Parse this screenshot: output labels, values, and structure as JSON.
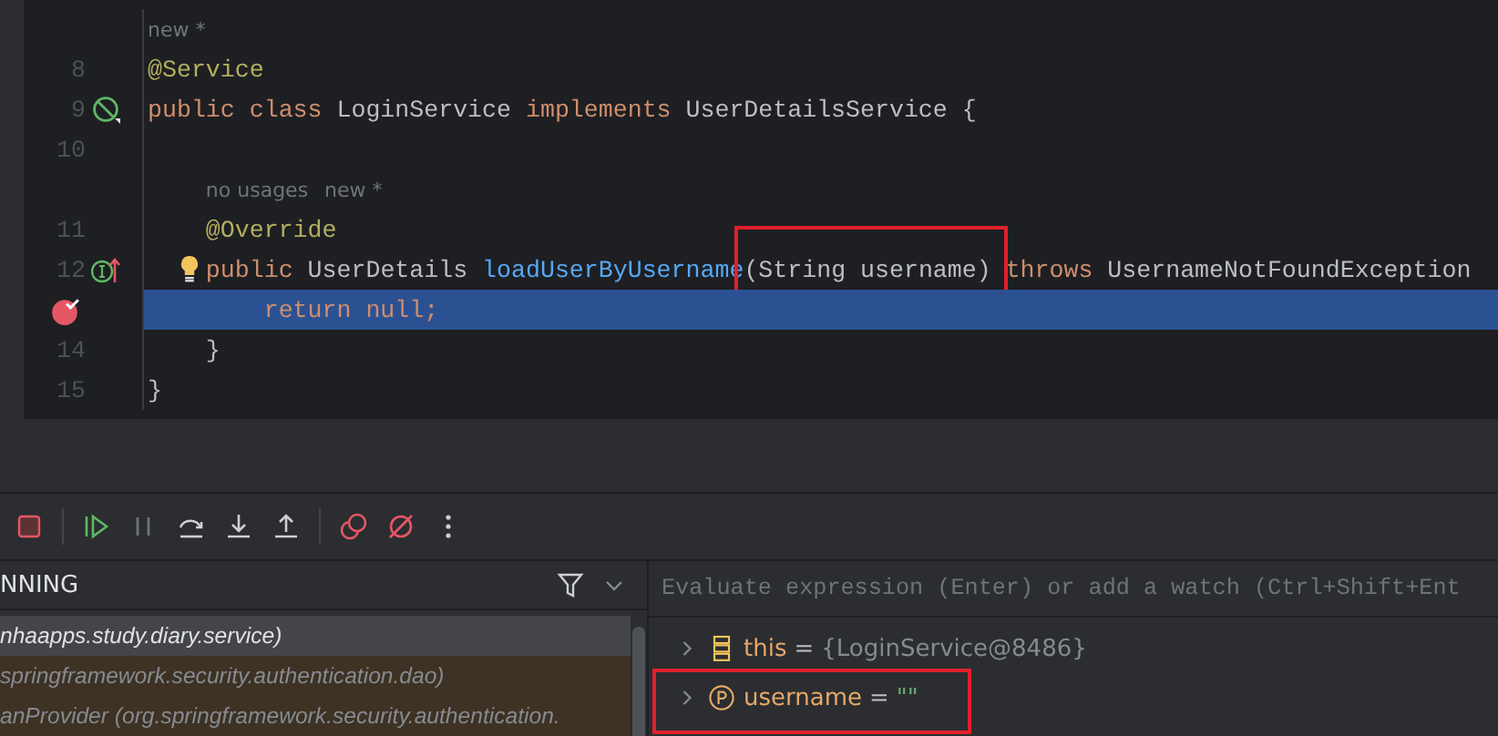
{
  "editor": {
    "lines": [
      {
        "kind": "annotation",
        "number": "8",
        "hints": [
          "new *"
        ],
        "tokens": [
          {
            "text": "@Service",
            "kind": "annotation"
          }
        ]
      },
      {
        "kind": "class",
        "number": "9",
        "tokens": [
          {
            "text": "public class",
            "kind": "keyword"
          },
          {
            "text": " LoginService ",
            "kind": "plain"
          },
          {
            "text": "implements",
            "kind": "keyword"
          },
          {
            "text": " UserDetailsService {",
            "kind": "plain"
          }
        ]
      },
      {
        "kind": "blank",
        "number": "10"
      },
      {
        "kind": "annotation",
        "number": "11",
        "hints": [
          "no usages",
          "new *"
        ],
        "tokens": [
          {
            "text": "    @Override",
            "kind": "annotation"
          }
        ]
      },
      {
        "kind": "method",
        "number": "12",
        "bulb": true,
        "tokens": [
          {
            "text": "    public",
            "kind": "keyword"
          },
          {
            "text": " UserDetails ",
            "kind": "plain"
          },
          {
            "text": "loadUserByUsername",
            "kind": "method"
          },
          {
            "text": "(String username)",
            "kind": "plain",
            "marked": true
          },
          {
            "text": " throws",
            "kind": "keyword"
          },
          {
            "text": " UsernameNotFoundException",
            "kind": "plain"
          }
        ]
      },
      {
        "kind": "statement",
        "breakpoint": true,
        "current": true,
        "tokens": [
          {
            "text": "        return null;",
            "kind": "keyword"
          }
        ]
      },
      {
        "kind": "brace",
        "number": "14",
        "tokens": [
          {
            "text": "    }",
            "kind": "plain"
          }
        ]
      },
      {
        "kind": "brace",
        "number": "15",
        "tokens": [
          {
            "text": "}",
            "kind": "plain"
          }
        ]
      }
    ]
  },
  "frames": {
    "header": "NNING",
    "rows": [
      {
        "text": "nhaapps.study.diary.service)",
        "selected": true,
        "kind": "app"
      },
      {
        "text": "springframework.security.authentication.dao)",
        "selected": false,
        "kind": "library"
      },
      {
        "text": "anProvider (org.springframework.security.authentication.",
        "selected": false,
        "kind": "library"
      }
    ]
  },
  "variables": {
    "placeholder": "Evaluate expression (Enter) or add a watch (Ctrl+Shift+Ent",
    "rows": [
      {
        "kind": "object",
        "name": "this",
        "separator": "=",
        "value": "{LoginService@8486}",
        "marked": false
      },
      {
        "kind": "parameter",
        "name": "username",
        "separator": "=",
        "value": "\"\"",
        "marked": true
      }
    ]
  }
}
